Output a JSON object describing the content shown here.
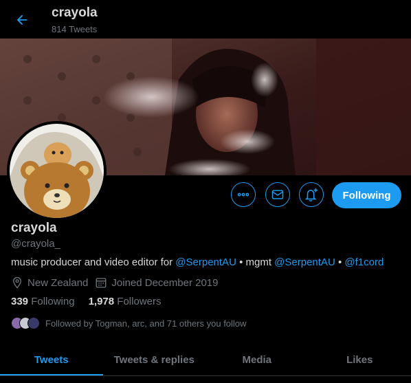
{
  "header": {
    "name": "crayola",
    "tweet_count": "814 Tweets",
    "back_icon": "arrow-left-icon"
  },
  "profile": {
    "display_name": "crayola",
    "handle": "@crayola_",
    "bio": {
      "prefix": "music producer and video editor for ",
      "mention1": "@SerpentAU",
      "sep1": " • mgmt ",
      "mention2": "@SerpentAU",
      "sep2": " • ",
      "mention3": "@f1cord"
    },
    "location": "New Zealand",
    "joined": "Joined December 2019",
    "following_count": "339",
    "following_label": "Following",
    "followers_count": "1,978",
    "followers_label": "Followers",
    "followed_by": "Followed by Togman, arc, and 71 others you follow"
  },
  "actions": {
    "more_icon": "more-horizontal-icon",
    "message_icon": "envelope-icon",
    "notify_icon": "bell-plus-icon",
    "follow_label": "Following"
  },
  "tabs": [
    {
      "label": "Tweets",
      "active": true
    },
    {
      "label": "Tweets & replies",
      "active": false
    },
    {
      "label": "Media",
      "active": false
    },
    {
      "label": "Likes",
      "active": false
    }
  ],
  "colors": {
    "accent": "#1d9bf0",
    "background": "#000000",
    "text": "#d9d9d9",
    "muted": "#6e767d"
  }
}
